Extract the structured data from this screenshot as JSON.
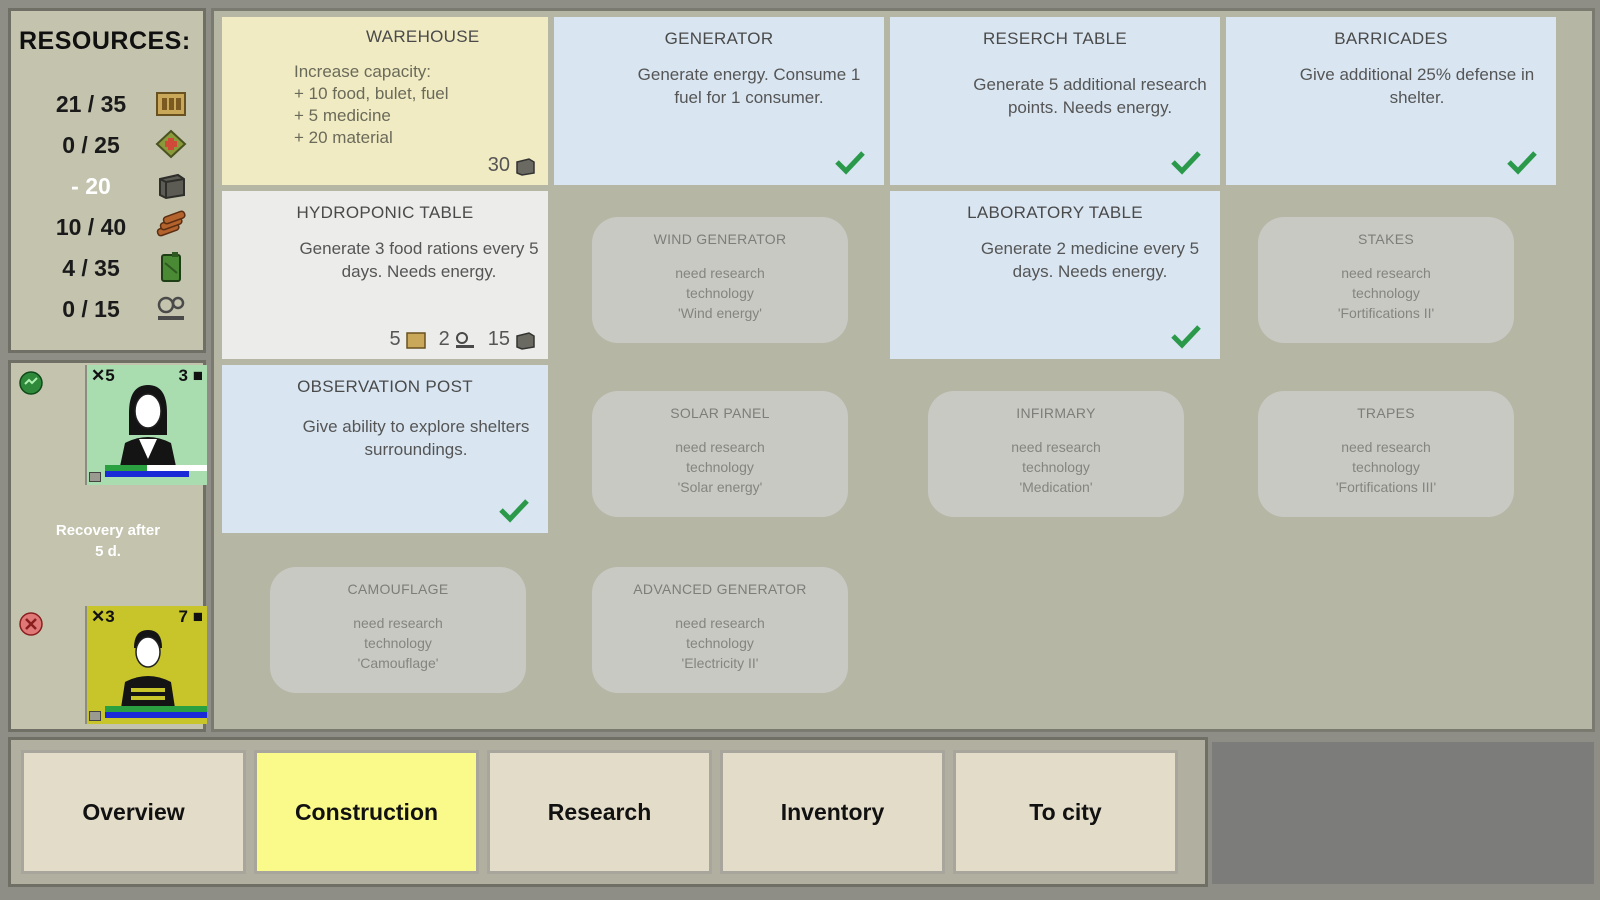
{
  "resources": {
    "title": "RESOURCES:",
    "rows": [
      {
        "value": "21 / 35",
        "icon": "food-icon",
        "color": "#b89a4a"
      },
      {
        "value": "0 / 25",
        "icon": "medicine-icon",
        "color": "#7a8a2c"
      },
      {
        "value": "- 20",
        "icon": "material-icon",
        "color": "#5a5a52"
      },
      {
        "value": "10 / 40",
        "icon": "bullet-icon",
        "color": "#a05a2c"
      },
      {
        "value": "4 / 35",
        "icon": "fuel-icon",
        "color": "#3e7a2e"
      },
      {
        "value": "0 / 15",
        "icon": "research-icon",
        "color": "#555555"
      }
    ]
  },
  "survivors": [
    {
      "count": "✕5",
      "armor": "3",
      "status": "healthy",
      "status_color": "#2e8a3a",
      "bg": "#a9ddb0",
      "bar_color": "#1a2ad6",
      "bar_fill": 0.85,
      "gender": "female"
    },
    {
      "count": "✕3",
      "armor": "7",
      "status": "injured",
      "status_color": "#d03a3a",
      "bg": "#c7c52a",
      "bar_color": "#1a2ad6",
      "bar_fill": 1.0,
      "gender": "male"
    }
  ],
  "recovery": {
    "line1": "Recovery after",
    "line2": "5 d."
  },
  "buildings": {
    "warehouse": {
      "title": "WAREHOUSE",
      "desc": [
        "Increase capacity:",
        "+ 10 food, bulet, fuel",
        "+ 5 medicine",
        "+ 20 material"
      ],
      "cost": "30"
    },
    "generator": {
      "title": "GENERATOR",
      "desc": "Generate energy. Consume 1 fuel for 1 consumer."
    },
    "research_table": {
      "title": "RESERCH TABLE",
      "desc": "Generate 5 additional research points. Needs energy."
    },
    "barricades": {
      "title": "BARRICADES",
      "desc": "Give additional 25% defense in shelter."
    },
    "hydroponic": {
      "title": "HYDROPONIC TABLE",
      "desc": "Generate 3 food rations every 5 days. Needs energy.",
      "cost": [
        "5",
        "2",
        "15"
      ]
    },
    "laboratory": {
      "title": "LABORATORY TABLE",
      "desc": "Generate 2 medicine every 5 days. Needs energy."
    },
    "observation": {
      "title": "OBSERVATION POST",
      "desc": "Give ability to explore shelters surroundings."
    },
    "wind": {
      "title": "WIND GENERATOR",
      "l1": "need research",
      "l2": "technology",
      "l3": "'Wind energy'"
    },
    "stakes": {
      "title": "STAKES",
      "l1": "need research",
      "l2": "technology",
      "l3": "'Fortifications II'"
    },
    "solar": {
      "title": "SOLAR PANEL",
      "l1": "need research",
      "l2": "technology",
      "l3": "'Solar energy'"
    },
    "infirmary": {
      "title": "INFIRMARY",
      "l1": "need research",
      "l2": "technology",
      "l3": "'Medication'"
    },
    "traps": {
      "title": "TRAPES",
      "l1": "need research",
      "l2": "technology",
      "l3": "'Fortifications III'"
    },
    "camouflage": {
      "title": "CAMOUFLAGE",
      "l1": "need research",
      "l2": "technology",
      "l3": "'Camouflage'"
    },
    "adv_generator": {
      "title": "ADVANCED GENERATOR",
      "l1": "need research",
      "l2": "technology",
      "l3": "'Electricity II'"
    }
  },
  "nav": {
    "overview": "Overview",
    "construction": "Construction",
    "research": "Research",
    "inventory": "Inventory",
    "to_city": "To city",
    "active": "construction"
  },
  "colors": {
    "check": "#2a9a4a",
    "built": "#d9e6f2",
    "locked": "#c9c9c4",
    "warehouse": "#f0ebc2",
    "active_tab": "#fafa8a"
  }
}
